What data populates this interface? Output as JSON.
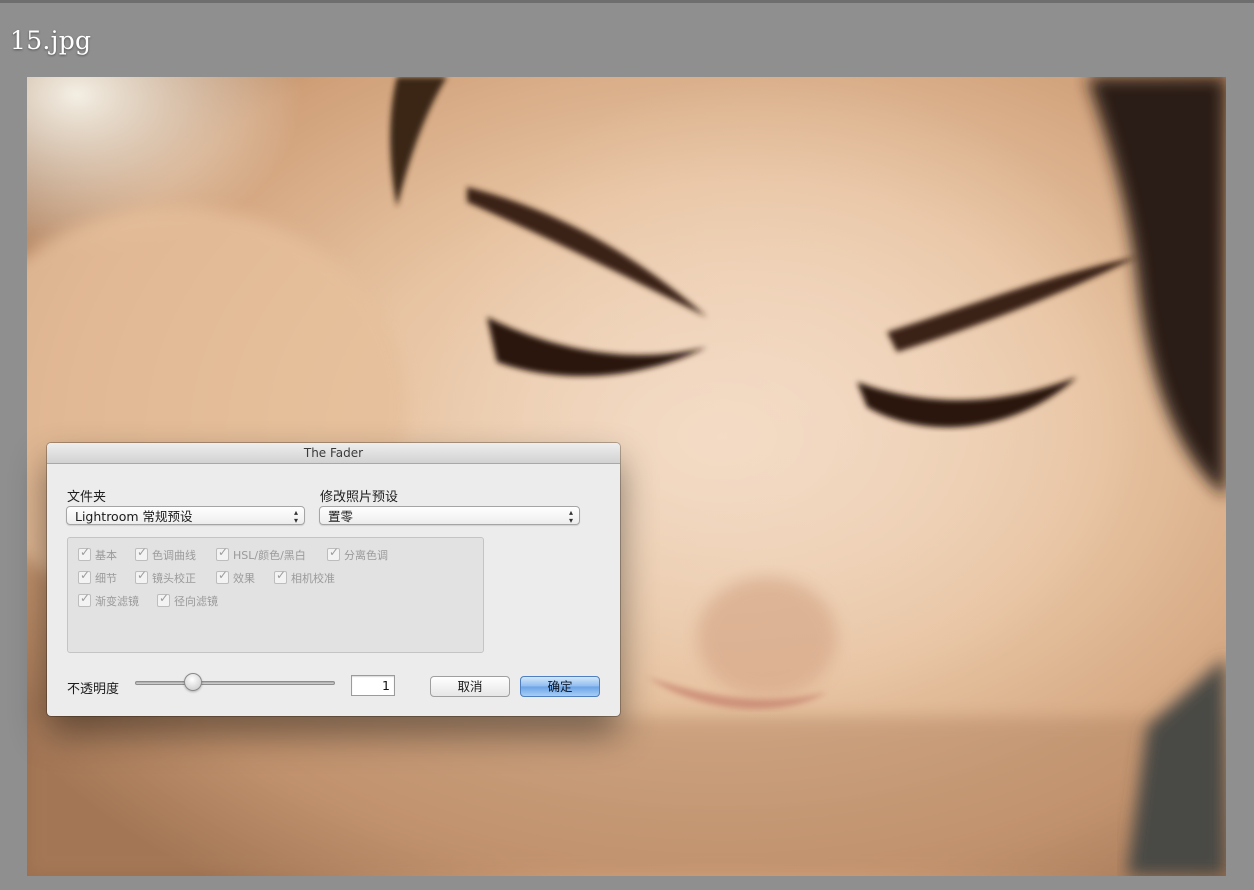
{
  "window": {
    "file_title": "15.jpg"
  },
  "dialog": {
    "title": "The Fader",
    "folder_label": "文件夹",
    "folder_value": "Lightroom 常规预设",
    "preset_label": "修改照片预设",
    "preset_value": "置零",
    "checkboxes": [
      {
        "label": "基本",
        "checked": true
      },
      {
        "label": "色调曲线",
        "checked": true
      },
      {
        "label": "HSL/颜色/黑白",
        "checked": true
      },
      {
        "label": "分离色调",
        "checked": true
      },
      {
        "label": "细节",
        "checked": true
      },
      {
        "label": "镜头校正",
        "checked": true
      },
      {
        "label": "效果",
        "checked": true
      },
      {
        "label": "相机校准",
        "checked": true
      },
      {
        "label": "渐变滤镜",
        "checked": true
      },
      {
        "label": "径向滤镜",
        "checked": true
      }
    ],
    "opacity_label": "不透明度",
    "opacity_value": "1",
    "opacity_slider_fraction": 0.27,
    "cancel_label": "取消",
    "ok_label": "确定"
  },
  "colors": {
    "accent_button": "#6aa3e6",
    "background": "#8f8f8f"
  },
  "icons": [
    "popup-arrows-icon",
    "checkmark-icon"
  ]
}
